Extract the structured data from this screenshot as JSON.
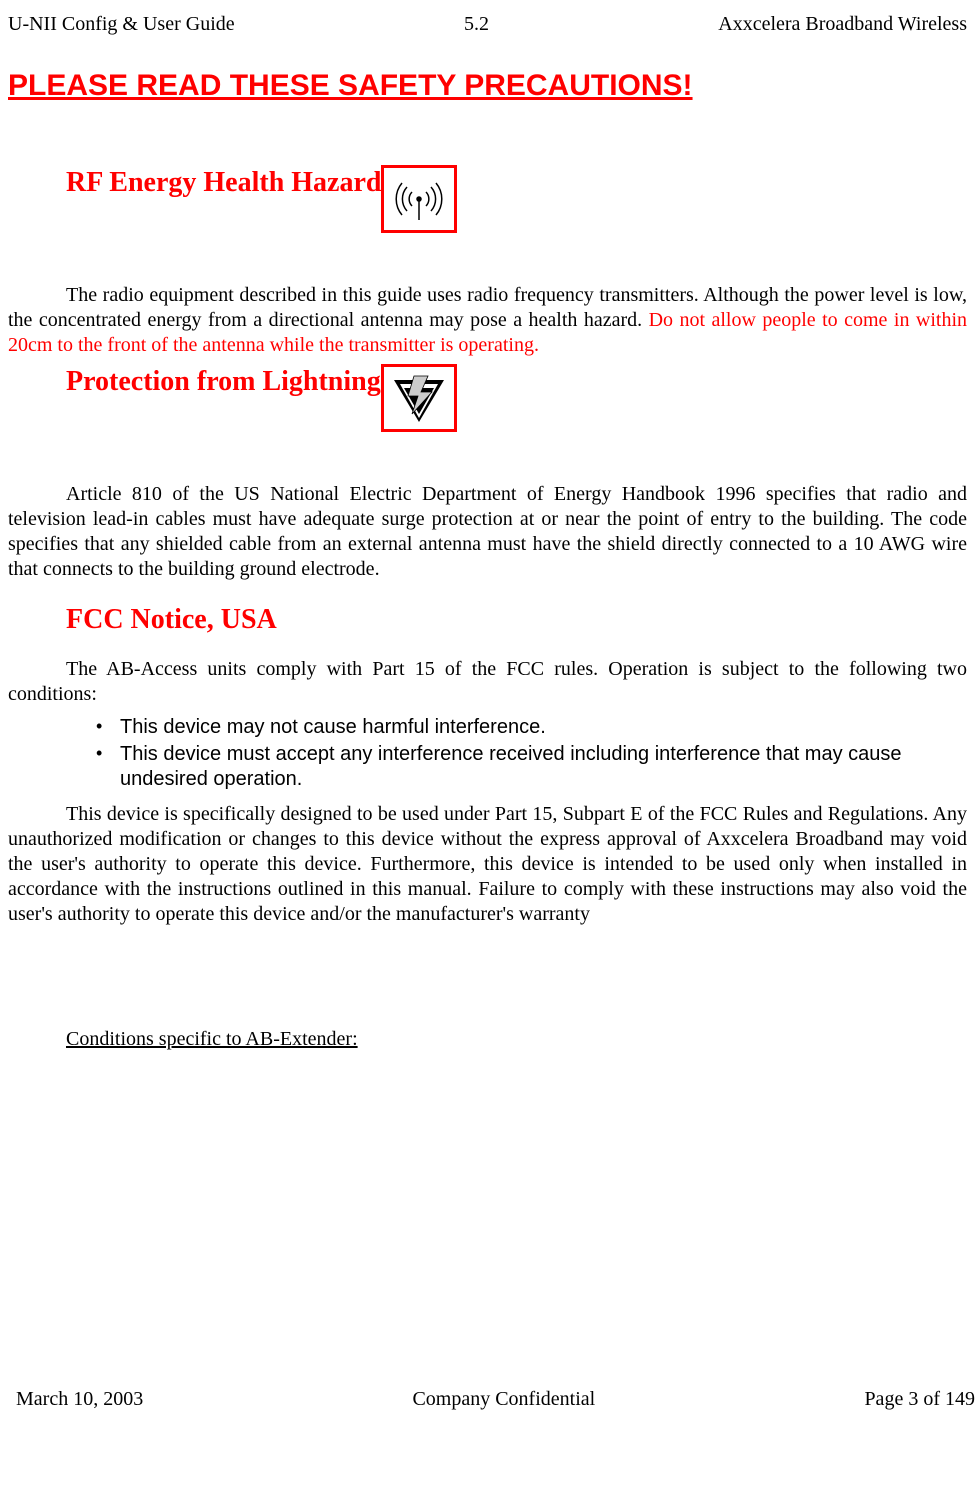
{
  "header": {
    "left": "U-NII Config & User Guide",
    "center": "5.2",
    "right": "Axxcelera Broadband Wireless"
  },
  "title": "PLEASE READ THESE SAFETY PRECAUTIONS!",
  "sections": {
    "rf": {
      "heading": "RF Energy Health Hazard",
      "icon": "rf-antenna-icon",
      "para_plain": "The radio equipment described in this guide uses radio frequency transmitters.  Although the power level is low, the concentrated energy from a directional antenna may pose a health hazard.  ",
      "para_red": "Do not allow people to come in within 20cm to the front of the antenna while the transmitter is operating."
    },
    "lightning": {
      "heading": "Protection from Lightning",
      "icon": "lightning-icon",
      "para": "Article 810 of the US National Electric Department of Energy Handbook 1996 specifies that radio and television lead-in cables must have adequate surge protection at or near the point of entry to the building.  The code specifies that any shielded cable from an external antenna must have the shield directly connected to a 10 AWG wire that connects to the building ground electrode."
    },
    "fcc": {
      "heading": "FCC Notice, USA",
      "intro": "The AB-Access units comply with Part 15 of the FCC rules.  Operation is subject to the following two conditions:",
      "bullets": [
        "This device may not cause harmful interference.",
        "This device must accept any interference received including interference that may cause undesired operation."
      ],
      "detail": "This device is specifically designed to be used under Part 15, Subpart E of the FCC Rules and Regulations.  Any unauthorized modification or changes to this device without the express approval of Axxcelera Broadband may void the user's authority to operate this device.  Furthermore, this device is intended to be used only when installed in accordance with the instructions outlined in this manual.  Failure to comply with these instructions may also void the user's authority to operate this device and/or the manufacturer's warranty",
      "conditions": "Conditions specific to AB-Extender:"
    }
  },
  "footer": {
    "left": "March 10, 2003",
    "center": "Company Confidential",
    "right": "Page 3 of 149"
  }
}
